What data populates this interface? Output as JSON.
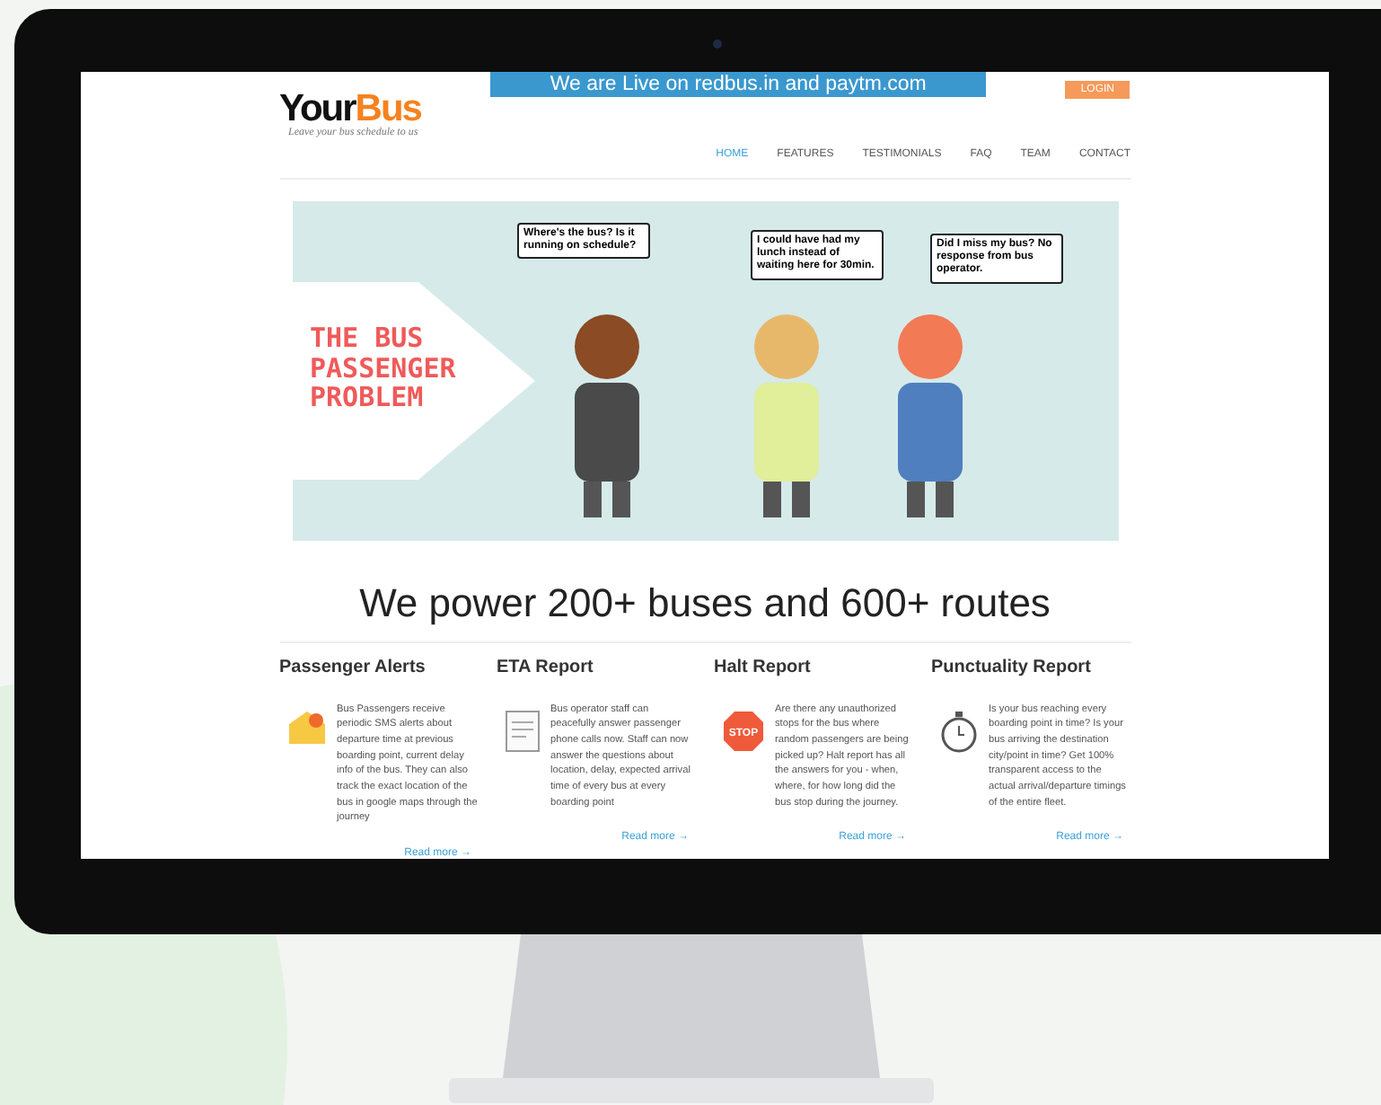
{
  "logo": {
    "first": "Your",
    "second": "Bus",
    "tagline": "Leave your bus schedule to us"
  },
  "banner": "We are Live on redbus.in and paytm.com",
  "login": "LOGIN",
  "nav": [
    {
      "label": "HOME",
      "selected": true
    },
    {
      "label": "FEATURES",
      "selected": false
    },
    {
      "label": "TESTIMONIALS",
      "selected": false
    },
    {
      "label": "FAQ",
      "selected": false
    },
    {
      "label": "TEAM",
      "selected": false
    },
    {
      "label": "CONTACT",
      "selected": false
    }
  ],
  "hero": {
    "title": "THE BUS PASSENGER PROBLEM",
    "bubbles": [
      "Where's the bus? Is it running on schedule?",
      "I could have had my lunch instead of waiting here for 30min.",
      "Did I miss my bus? No response from bus operator."
    ]
  },
  "headline": "We power 200+ buses and 600+ routes",
  "features": [
    {
      "kind": "alert",
      "title": "Passenger Alerts",
      "text": "Bus Passengers receive periodic SMS alerts about departure time at previous boarding point, current delay info of the bus. They can also track the exact location of the bus in google maps through the journey",
      "link": "Read more →"
    },
    {
      "kind": "report",
      "title": "ETA Report",
      "text": "Bus operator staff can peacefully answer passenger phone calls now. Staff can now answer the questions about location, delay, expected arrival time of every bus at every boarding point",
      "link": "Read more →"
    },
    {
      "kind": "stop",
      "title": "Halt Report",
      "badge": "STOP",
      "text": "Are there any unauthorized stops for the bus where random passengers are being picked up? Halt report has all the answers for you - when, where, for how long did the bus stop during the journey.",
      "link": "Read more →"
    },
    {
      "kind": "clock",
      "title": "Punctuality Report",
      "text": "Is your bus reaching every boarding point in time? Is your bus arriving the destination city/point in time? Get 100% transparent access to the actual arrival/departure timings of the entire fleet.",
      "link": "Read more →"
    }
  ]
}
